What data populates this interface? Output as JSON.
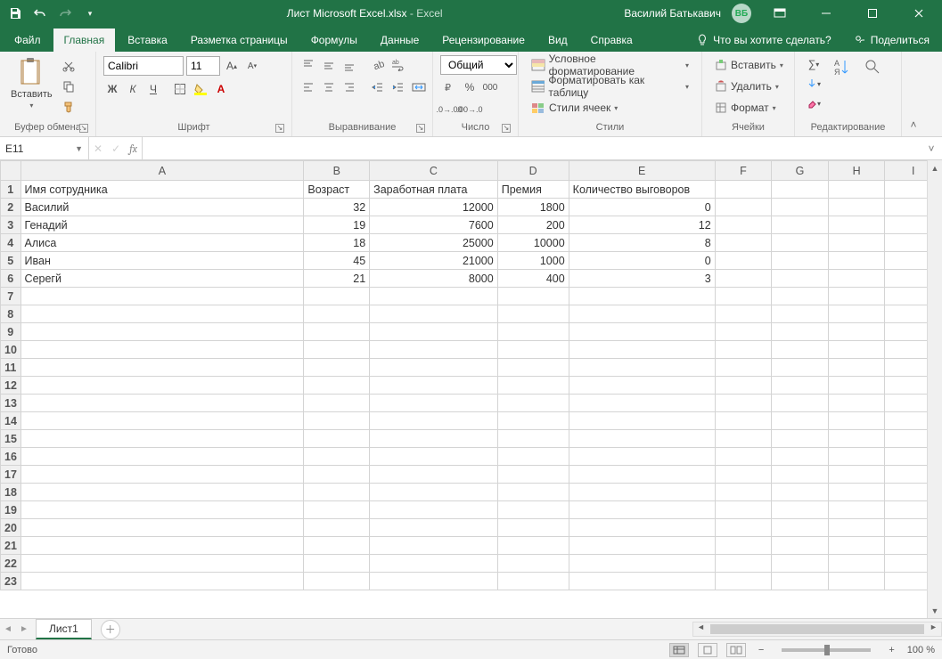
{
  "title": {
    "doc": "Лист Microsoft Excel.xlsx",
    "sep": " - ",
    "app": "Excel"
  },
  "user": {
    "name": "Василий Батькавич",
    "initials": "ВБ"
  },
  "tabs": {
    "file": "Файл",
    "items": [
      "Главная",
      "Вставка",
      "Разметка страницы",
      "Формулы",
      "Данные",
      "Рецензирование",
      "Вид",
      "Справка"
    ],
    "active": 0,
    "tell": "Что вы хотите сделать?",
    "share": "Поделиться"
  },
  "ribbon": {
    "clipboard": {
      "paste": "Вставить",
      "label": "Буфер обмена"
    },
    "font": {
      "name": "Calibri",
      "size": "11",
      "bold": "Ж",
      "italic": "К",
      "underline": "Ч",
      "label": "Шрифт"
    },
    "alignment": {
      "label": "Выравнивание"
    },
    "number": {
      "format": "Общий",
      "label": "Число"
    },
    "styles": {
      "cond": "Условное форматирование",
      "table": "Форматировать как таблицу",
      "cell": "Стили ячеек",
      "label": "Стили"
    },
    "cells": {
      "insert": "Вставить",
      "delete": "Удалить",
      "format": "Формат",
      "label": "Ячейки"
    },
    "editing": {
      "label": "Редактирование"
    }
  },
  "namebox": "E11",
  "columns": [
    "A",
    "B",
    "C",
    "D",
    "E",
    "F",
    "G",
    "H",
    "I"
  ],
  "colWidths": [
    "colA",
    "colB",
    "colC",
    "colD",
    "colE",
    "colF",
    "colG",
    "colH",
    "colI"
  ],
  "headers": {
    "A": "Имя сотрудника",
    "B": "Возраст",
    "C": "Заработная плата",
    "D": "Премия",
    "E": "Количество выговоров"
  },
  "rows": [
    {
      "A": "Василий",
      "B": 32,
      "C": 12000,
      "D": 1800,
      "E": 0
    },
    {
      "A": "Генадий",
      "B": 19,
      "C": 7600,
      "D": 200,
      "E": 12
    },
    {
      "A": "Алиса",
      "B": 18,
      "C": 25000,
      "D": 10000,
      "E": 8
    },
    {
      "A": "Иван",
      "B": 45,
      "C": 21000,
      "D": 1000,
      "E": 0
    },
    {
      "A": "Серегй",
      "B": 21,
      "C": 8000,
      "D": 400,
      "E": 3
    }
  ],
  "totalGridRows": 23,
  "sheet": {
    "name": "Лист1"
  },
  "status": {
    "ready": "Готово",
    "zoom": "100 %"
  }
}
